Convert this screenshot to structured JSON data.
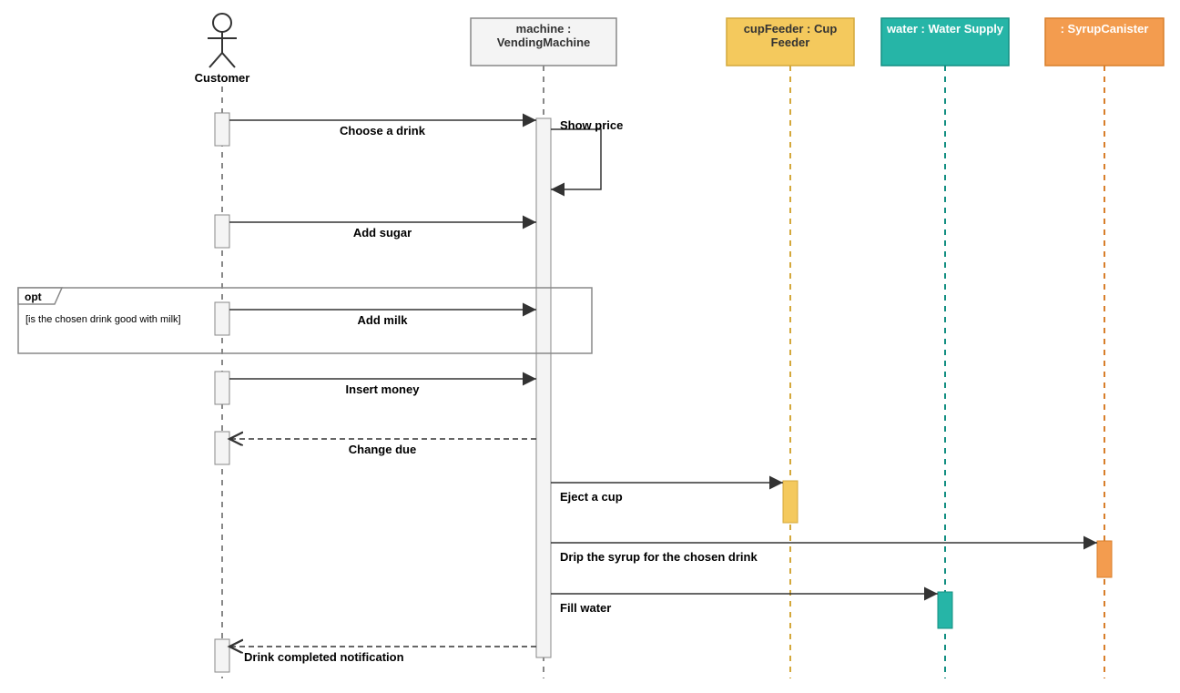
{
  "lifelines": {
    "customer": {
      "label": "Customer"
    },
    "machine": {
      "label": "machine : VendingMachine"
    },
    "cupFeeder": {
      "label": "cupFeeder : Cup Feeder"
    },
    "water": {
      "label": "water : Water Supply"
    },
    "syrup": {
      "label": ": SyrupCanister"
    }
  },
  "messages": {
    "chooseDrink": "Choose a drink",
    "showPrice": "Show price",
    "addSugar": "Add sugar",
    "addMilk": "Add milk",
    "insertMoney": "Insert money",
    "changeDue": "Change due",
    "ejectCup": "Eject a cup",
    "dripSyrup": "Drip the syrup for the chosen drink",
    "fillWater": "Fill water",
    "drinkCompleted": "Drink completed notification"
  },
  "fragment": {
    "optLabel": "opt",
    "guard": "[is the chosen drink good with milk]"
  },
  "colors": {
    "customerFill": "#F4F4F4",
    "customerStroke": "#888888",
    "machineFill": "#F4F4F4",
    "machineStroke": "#888888",
    "cupFeederFill": "#F4C95D",
    "cupFeederStroke": "#D4A83B",
    "waterFill": "#26B5A7",
    "waterStroke": "#148F82",
    "syrupFill": "#F39C4F",
    "syrupStroke": "#D87E2A"
  }
}
